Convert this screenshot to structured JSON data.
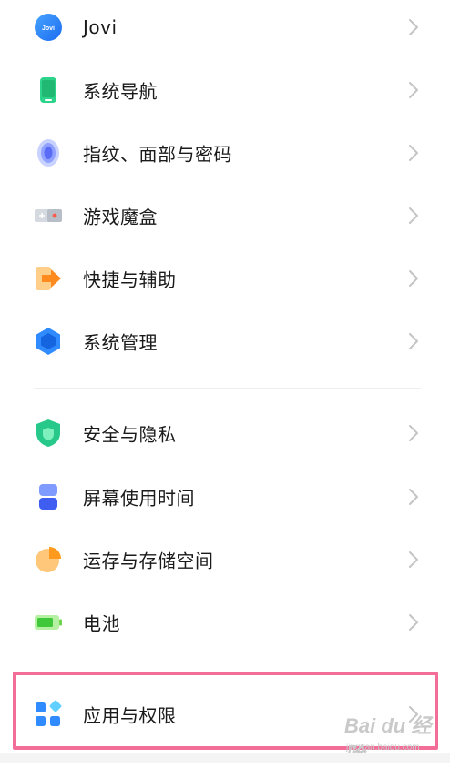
{
  "settings_list": {
    "items": [
      {
        "label": "Jovi",
        "icon": "jovi-icon"
      },
      {
        "label": "系统导航",
        "icon": "navigation-icon"
      },
      {
        "label": "指纹、面部与密码",
        "icon": "fingerprint-icon"
      },
      {
        "label": "游戏魔盒",
        "icon": "game-box-icon"
      },
      {
        "label": "快捷与辅助",
        "icon": "shortcut-icon"
      },
      {
        "label": "系统管理",
        "icon": "system-management-icon"
      },
      {
        "label": "安全与隐私",
        "icon": "shield-icon"
      },
      {
        "label": "屏幕使用时间",
        "icon": "hourglass-icon"
      },
      {
        "label": "运存与存储空间",
        "icon": "storage-pie-icon"
      },
      {
        "label": "电池",
        "icon": "battery-icon"
      },
      {
        "label": "应用与权限",
        "icon": "apps-icon"
      }
    ]
  },
  "highlight_color": "#f26d98",
  "watermark": {
    "main": "Bai du 经验",
    "sub": "jingyan.baidu.com"
  }
}
